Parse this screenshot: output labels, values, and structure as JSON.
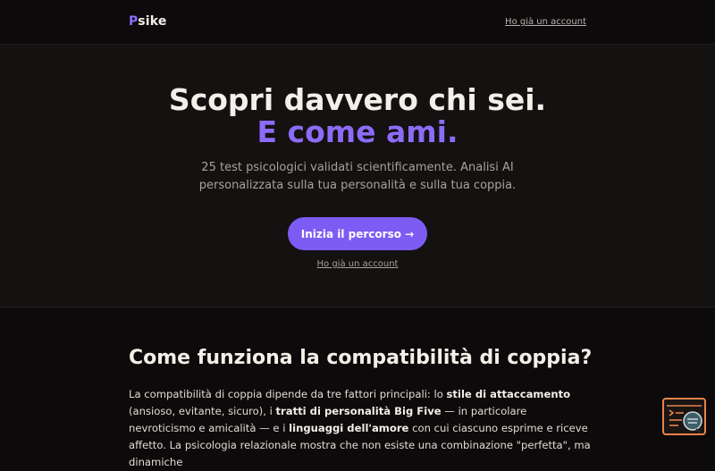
{
  "nav": {
    "logo_first": "P",
    "logo_rest": "sike",
    "login_link": "Ho già un account"
  },
  "hero": {
    "title_line1": "Scopri davvero chi sei.",
    "title_line2": "E come ami.",
    "subtitle_line1": "25 test psicologici validati scientificamente. Analisi AI",
    "subtitle_line2": "personalizzata sulla tua personalità e sulla tua coppia.",
    "cta_label": "Inizia il percorso →",
    "login_link": "Ho già un account"
  },
  "section": {
    "title": "Come funziona la compatibilità di coppia?",
    "p1": "La compatibilità di coppia dipende da tre fattori principali: lo ",
    "b1": "stile di attaccamento",
    "p2": " (ansioso, evitante, sicuro), i ",
    "b2": "tratti di personalità Big Five",
    "p3": " — in particolare nevroticismo e amicalità — e i ",
    "b3": "linguaggi dell'amore",
    "p4": " con cui ciascuno esprime e riceve affetto. La psicologia relazionale mostra che non esiste una combinazione \"perfetta\", ma dinamiche"
  },
  "widget": {
    "icon": "feedback-terminal-icon"
  },
  "colors": {
    "background": "#0c0a0a",
    "hero_background": "#141111",
    "accent": "#8b6cf6",
    "button": "#7c5cf2",
    "widget_border": "#e8834b"
  }
}
